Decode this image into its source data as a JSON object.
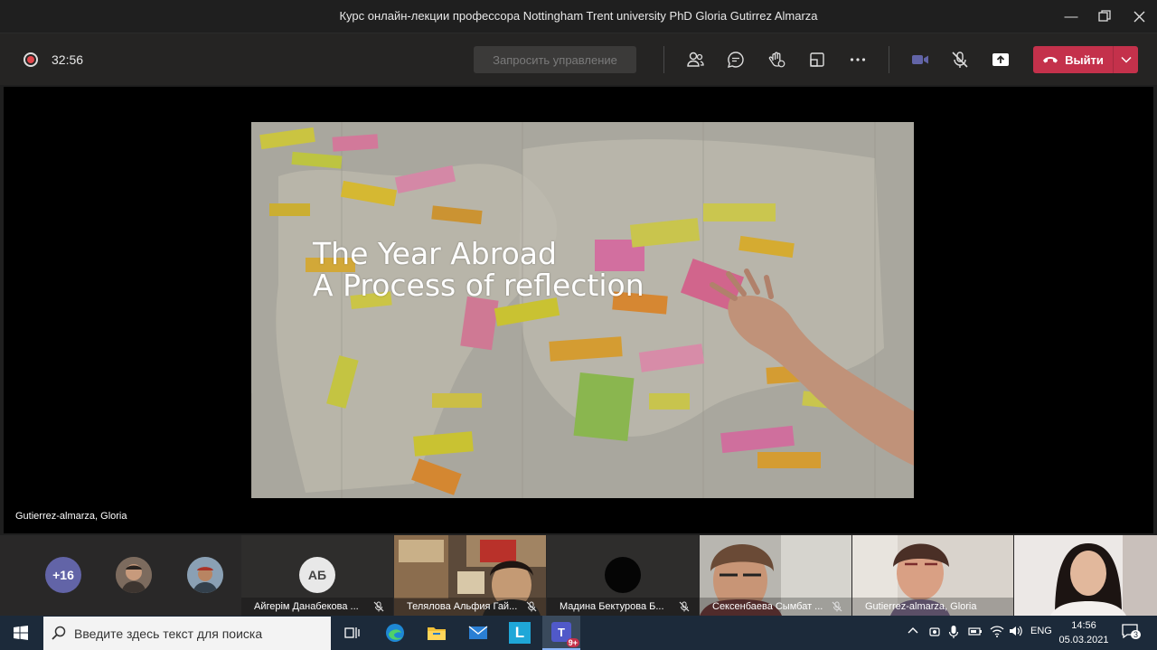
{
  "window": {
    "title": "Курс онлайн-лекции профессора Nottingham Trent university PhD Gloria Gutirrez Almarza",
    "controls": [
      "minimize-icon",
      "maximize-icon",
      "close-icon"
    ]
  },
  "toolbar": {
    "timer": "32:56",
    "request_control_label": "Запросить управление",
    "leave_label": "Выйти",
    "icons": [
      "participants-icon",
      "chat-icon",
      "reactions-icon",
      "rooms-icon",
      "more-icon",
      "camera-icon",
      "mic-off-icon",
      "share-icon"
    ],
    "leave_color": "#c4314b"
  },
  "stage": {
    "slide_line1": "The Year Abroad",
    "slide_line2": "A Process of reflection",
    "presenter_name": "Gutierrez-almarza, Gloria"
  },
  "participants": {
    "overflow_count": "+16",
    "tiles": [
      {
        "initials": "АБ",
        "name": "Айгерім Данабекова ..."
      },
      {
        "name": "Телялова Альфия Гай..."
      },
      {
        "name": "Мадина Бектурова Б..."
      },
      {
        "name": "Сексенбаева Сымбат ..."
      },
      {
        "name": "Gutierrez-almarza, Gloria"
      }
    ]
  },
  "taskbar": {
    "search_placeholder": "Введите здесь текст для поиска",
    "language": "ENG",
    "time": "14:56",
    "date": "05.03.2021",
    "teams_badge": "9+",
    "notification_count": "3",
    "apps": [
      "windows-icon",
      "task-view-icon",
      "edge-icon",
      "explorer-icon",
      "mail-icon",
      "lingualeo-icon",
      "teams-icon"
    ]
  }
}
